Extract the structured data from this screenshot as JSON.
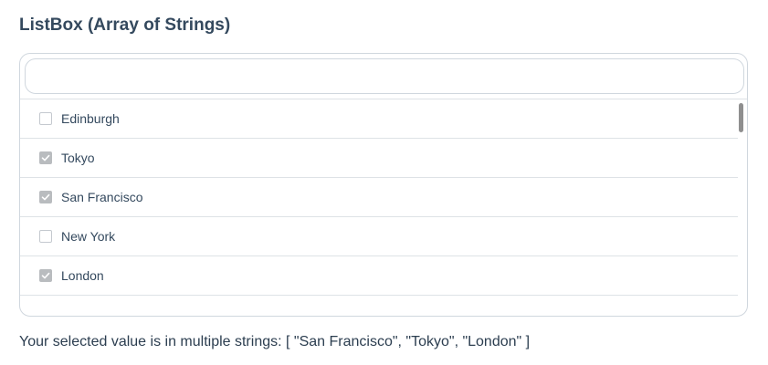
{
  "title": "ListBox (Array of Strings)",
  "filter": {
    "value": "",
    "placeholder": ""
  },
  "items": [
    {
      "label": "Edinburgh",
      "checked": false
    },
    {
      "label": "Tokyo",
      "checked": true
    },
    {
      "label": "San Francisco",
      "checked": true
    },
    {
      "label": "New York",
      "checked": false
    },
    {
      "label": "London",
      "checked": true
    }
  ],
  "result_text": "Your selected value is in multiple strings: [ \"San Francisco\", \"Tokyo\", \"London\" ]",
  "colors": {
    "text": "#2c3e50",
    "border": "#d0d7de",
    "checked_fill": "#b9bcbf",
    "scroll_thumb": "#8f8f8f"
  }
}
